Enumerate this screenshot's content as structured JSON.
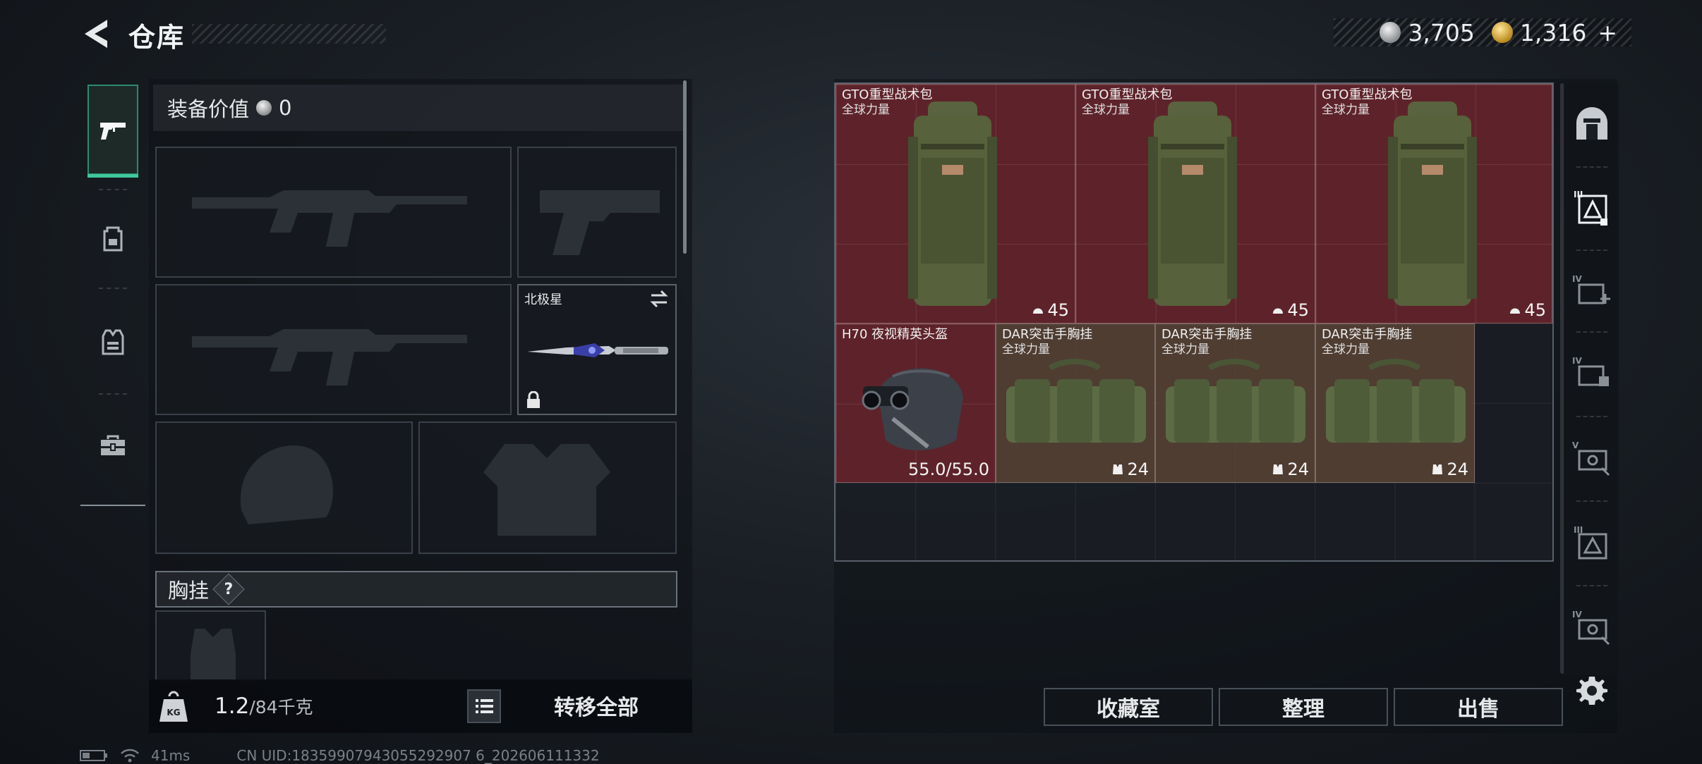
{
  "header": {
    "title": "仓库",
    "back_icon": "back-arrow-icon",
    "currencies": [
      {
        "icon": "silver-coin-icon",
        "value": "3,705"
      },
      {
        "icon": "gold-coin-icon",
        "value": "1,316"
      }
    ],
    "add_label": "+"
  },
  "left_tabs": [
    {
      "icon": "pistol-icon",
      "active": true
    },
    {
      "icon": "backpack-icon",
      "active": false
    },
    {
      "icon": "vest-icon",
      "active": false
    },
    {
      "icon": "toolbox-icon",
      "active": false
    }
  ],
  "equipment": {
    "value_label": "装备价值",
    "value": "0",
    "melee_name": "北极星",
    "chest_label": "胸挂",
    "help_symbol": "?",
    "weight_current": "1.2",
    "weight_capacity": "/84千克",
    "weight_icon_text": "KG",
    "transfer_all": "转移全部"
  },
  "storage": {
    "items": [
      {
        "name": "GTO重型战术包",
        "sub": "全球力量",
        "stat": "45",
        "stat_icon": "helmet-capacity-icon",
        "rarity": "red"
      },
      {
        "name": "GTO重型战术包",
        "sub": "全球力量",
        "stat": "45",
        "stat_icon": "helmet-capacity-icon",
        "rarity": "red"
      },
      {
        "name": "GTO重型战术包",
        "sub": "全球力量",
        "stat": "45",
        "stat_icon": "helmet-capacity-icon",
        "rarity": "red"
      },
      {
        "name": "H70 夜视精英头盔",
        "sub": "",
        "stat": "55.0/55.0",
        "stat_icon": "",
        "rarity": "red"
      },
      {
        "name": "DAR突击手胸挂",
        "sub": "全球力量",
        "stat": "24",
        "stat_icon": "vest-capacity-icon",
        "rarity": "brown"
      },
      {
        "name": "DAR突击手胸挂",
        "sub": "全球力量",
        "stat": "24",
        "stat_icon": "vest-capacity-icon",
        "rarity": "brown"
      },
      {
        "name": "DAR突击手胸挂",
        "sub": "全球力量",
        "stat": "24",
        "stat_icon": "vest-capacity-icon",
        "rarity": "brown"
      }
    ],
    "buttons": {
      "vault": "收藏室",
      "sort": "整理",
      "sell": "出售"
    }
  },
  "filters": [
    {
      "icon": "all-items-icon"
    },
    {
      "icon": "tier3-backpack-filter-icon"
    },
    {
      "icon": "tier4-medkit-filter-icon"
    },
    {
      "icon": "tier4-ammo-filter-icon"
    },
    {
      "icon": "tier5-key-filter-icon"
    },
    {
      "icon": "tier3-backpack-filter-icon-2"
    },
    {
      "icon": "tier4-key-filter-icon"
    }
  ],
  "status_bar": {
    "ping": "41ms",
    "uid": "CN UID:18359907943055292907 6_202606111332"
  },
  "colors": {
    "accent": "#3fc99a",
    "rarity_red": "#6e242c",
    "rarity_brown": "#5c4436"
  }
}
